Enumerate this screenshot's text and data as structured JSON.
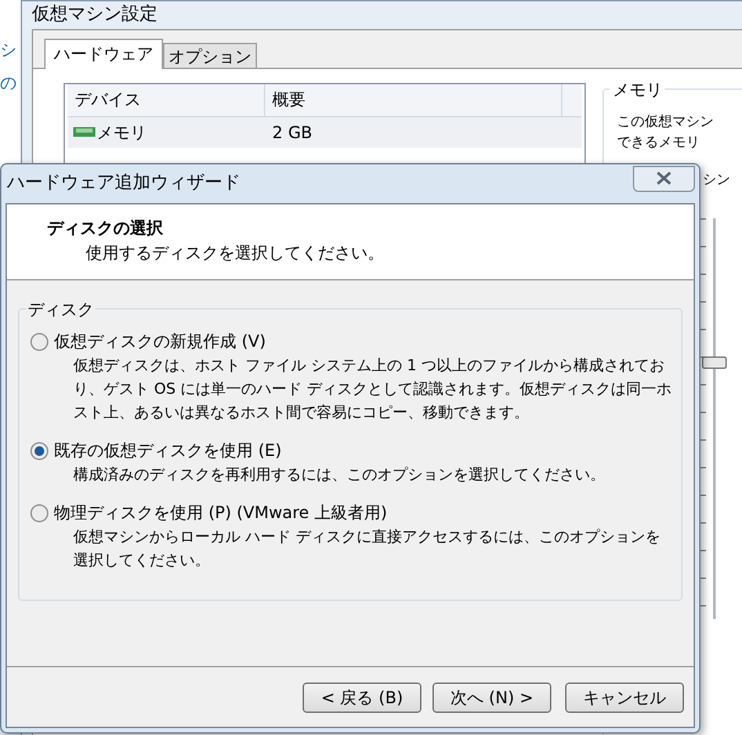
{
  "background_fragments": [
    "シ",
    "の"
  ],
  "settings_window": {
    "title": "仮想マシン設定",
    "tabs": [
      {
        "label": "ハードウェア",
        "selected": true
      },
      {
        "label": "オプション",
        "selected": false
      }
    ],
    "device_table": {
      "columns": [
        "デバイス",
        "概要"
      ],
      "rows": [
        {
          "device": "メモリ",
          "summary": "2 GB"
        }
      ]
    },
    "memory_group": {
      "title": "メモリ",
      "lines": [
        "この仮想マシン",
        "できるメモリ",
        "シン"
      ],
      "slider": {
        "level": 0.64
      }
    }
  },
  "wizard": {
    "title": "ハードウェア追加ウィザード",
    "header": {
      "title": "ディスクの選択",
      "subtitle": "使用するディスクを選択してください。"
    },
    "group_title": "ディスク",
    "options": [
      {
        "label": "仮想ディスクの新規作成 (V)",
        "selected": false,
        "description": "仮想ディスクは、ホスト ファイル システム上の 1 つ以上のファイルから構成されており、ゲスト OS には単一のハード ディスクとして認識されます。仮想ディスクは同一ホスト上、あるいは異なるホスト間で容易にコピー、移動できます。"
      },
      {
        "label": "既存の仮想ディスクを使用 (E)",
        "selected": true,
        "description": "構成済みのディスクを再利用するには、このオプションを選択してください。"
      },
      {
        "label": "物理ディスクを使用 (P) (VMware 上級者用)",
        "selected": false,
        "description": "仮想マシンからローカル ハード ディスクに直接アクセスするには、このオプションを選択してください。"
      }
    ],
    "buttons": [
      "< 戻る (B)",
      "次へ (N) >",
      "キャンセル"
    ]
  }
}
